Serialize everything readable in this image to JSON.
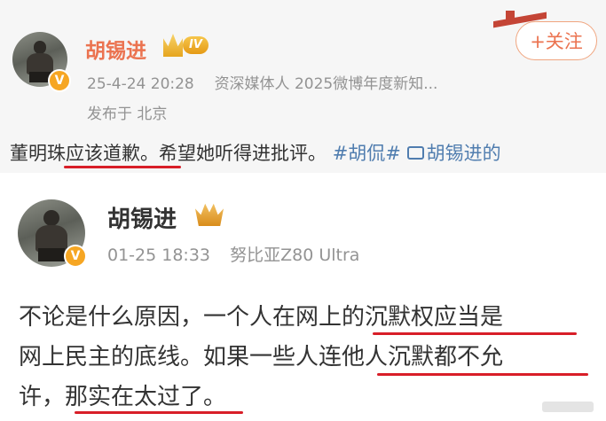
{
  "post1": {
    "author": "胡锡进",
    "level_badge": "IV",
    "verify_mark": "V",
    "timestamp": "25-4-24 20:28",
    "description": "资深媒体人 2025微博年度新知...",
    "location": "发布于 北京",
    "follow_label": "+关注",
    "text_segments": [
      "董明珠应该道歉。希望她听得进批评。",
      "#胡侃#",
      "胡锡进的"
    ]
  },
  "post2": {
    "author": "胡锡进",
    "verify_mark": "V",
    "timestamp": "01-25 18:33",
    "device": "努比亚Z80 Ultra",
    "text_lines": [
      "不论是什么原因，一个人在网上的沉默权应当是",
      "网上民主的底线。如果一些人连他人沉默都不允",
      "许，那实在太过了。"
    ]
  },
  "colors": {
    "name_orange": "#eb7350",
    "link_blue": "#507daf",
    "underline_red": "#d81e28",
    "meta_gray": "#939393"
  }
}
